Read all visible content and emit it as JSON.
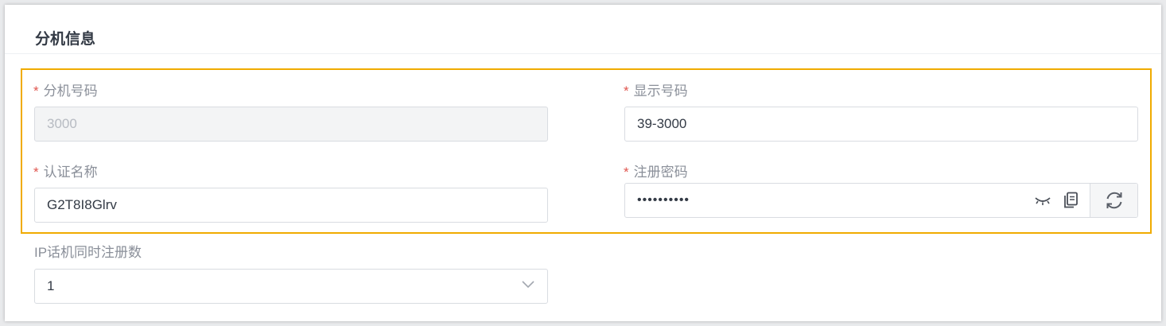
{
  "section": {
    "title": "分机信息"
  },
  "form": {
    "required_mark": "*",
    "extension_number": {
      "label": "分机号码",
      "value": "3000"
    },
    "caller_id": {
      "label": "显示号码",
      "value": "39-3000"
    },
    "auth_name": {
      "label": "认证名称",
      "value": "G2T8I8Glrv"
    },
    "register_password": {
      "label": "注册密码",
      "value": "••••••••••"
    },
    "concurrent_registrations": {
      "label": "IP话机同时注册数",
      "value": "1"
    }
  },
  "icons": {
    "visibility": "eye-closed-icon",
    "copy": "copy-icon",
    "refresh": "refresh-icon",
    "dropdown": "chevron-down-icon"
  },
  "colors": {
    "highlight_border": "#f0ab00",
    "required": "#e0564f",
    "label": "#8a8f99",
    "text": "#333a45"
  }
}
